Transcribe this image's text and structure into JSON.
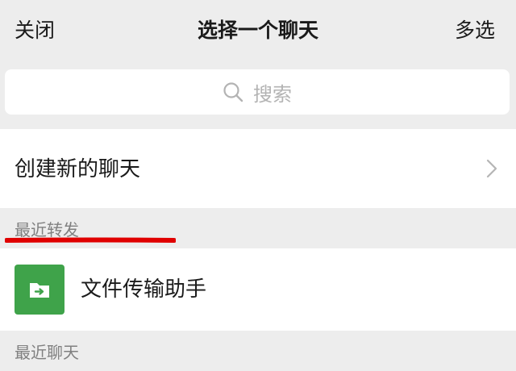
{
  "header": {
    "close_label": "关闭",
    "title": "选择一个聊天",
    "multi_select_label": "多选"
  },
  "search": {
    "placeholder": "搜索",
    "icon": "search-icon"
  },
  "create_chat": {
    "label": "创建新的聊天",
    "icon": "chevron-right-icon"
  },
  "sections": {
    "recent_forward": "最近转发",
    "recent_chats": "最近聊天"
  },
  "recent_forward_items": [
    {
      "label": "文件传输助手",
      "icon": "folder-arrow-icon",
      "avatar_color": "#3fa34a"
    }
  ],
  "colors": {
    "background": "#ededed",
    "row": "#ffffff",
    "accent_green": "#3fa34a",
    "annotation_red": "#e00000"
  }
}
